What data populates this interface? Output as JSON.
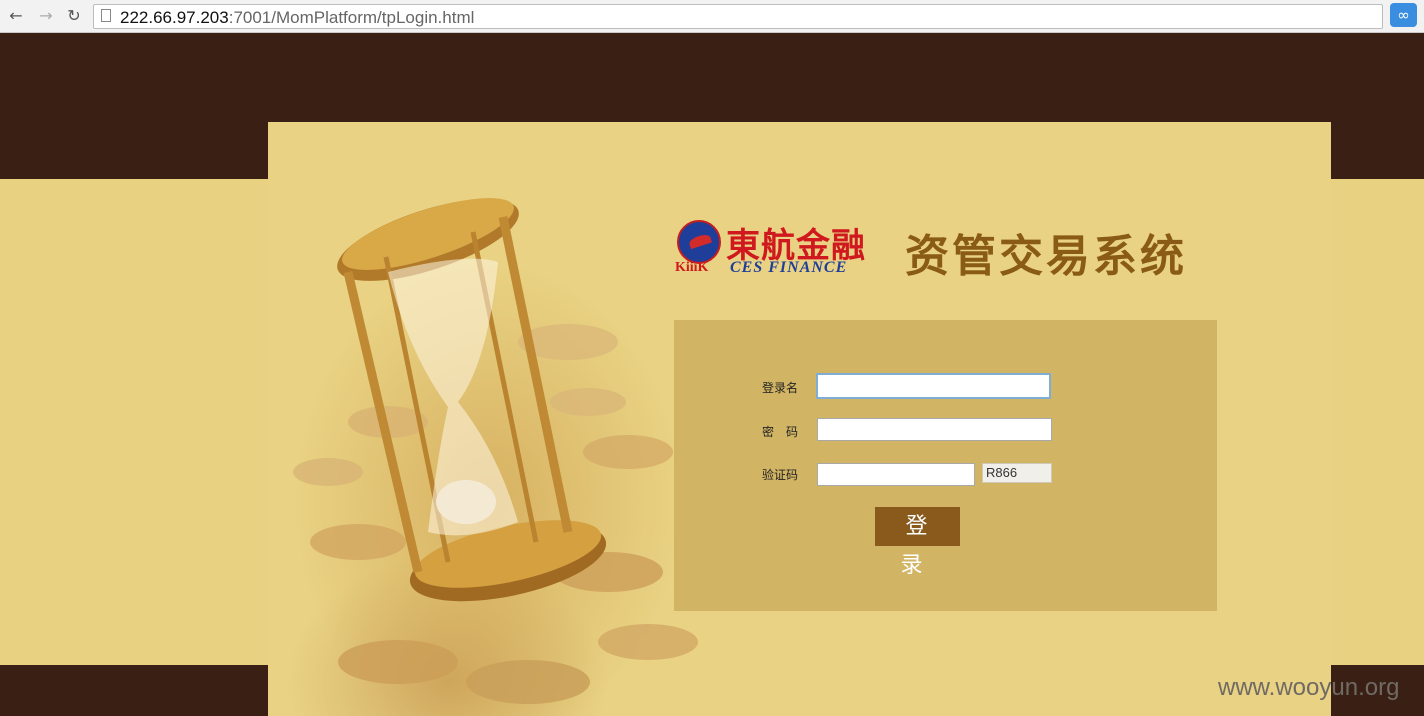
{
  "browser": {
    "url_host": "222.66.97.203",
    "url_rest": ":7001/MomPlatform/tpLogin.html"
  },
  "brand": {
    "cn": "東航金融",
    "kiik": "KiiiK",
    "en": "CES FINANCE"
  },
  "system_title": "资管交易系统",
  "form": {
    "username_label": "登录名",
    "username_value": "",
    "password_label": "密　码",
    "password_value": "",
    "captcha_label": "验证码",
    "captcha_value": "",
    "captcha_code": "R866",
    "login_button": "登 录"
  },
  "watermark": "www.wooyun.org",
  "colors": {
    "dark_band": "#3a1f14",
    "panel": "#e9d283",
    "form_box": "#d2b564",
    "button": "#8a5a1c",
    "title": "#8a5b16"
  },
  "icons": [
    "back-icon",
    "forward-icon",
    "reload-icon",
    "page-icon",
    "extension-icon",
    "airline-logo-icon"
  ]
}
